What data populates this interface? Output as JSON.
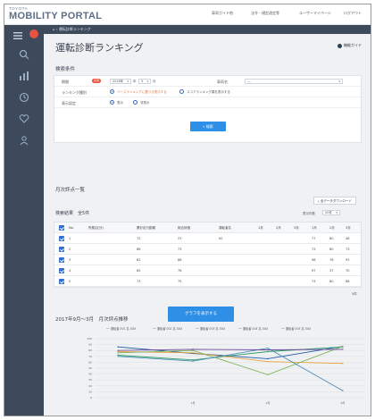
{
  "header": {
    "brand_small": "TOYOTA",
    "brand_big": "MOBILITY PORTAL",
    "nav": [
      "車両ガイド他",
      "法令・規定改定等",
      "ユーザーマイページ",
      "ログアウト"
    ]
  },
  "breadcrumb": {
    "text": "運転診断ランキング"
  },
  "page": {
    "title": "運転診断ランキング",
    "help_label": "機能ガイド"
  },
  "search": {
    "section_title": "検索条件",
    "required_badge": "必須",
    "period_label": "期間",
    "year_value": "2018年",
    "month_from": "5",
    "month_to": "月",
    "vehicle_label": "車両名",
    "vehicle_value": "---",
    "ranking_label": "ランキング種別",
    "ranking_opt1": "ベースランキングに基づき表示する",
    "ranking_opt2": "スコアランキング順を表示する",
    "display_label": "表示設定",
    "display_opt1": "表示",
    "display_opt2": "非表示",
    "search_button": "検索"
  },
  "results": {
    "section_title": "月次評点一覧",
    "export_label": "全データダウンロード",
    "count_label": "検索結果　全5件",
    "per_page_label": "表示件数",
    "per_page_value": "20件",
    "columns": [
      "No.",
      "所属(区分)",
      "累計走行距離",
      "総合評価",
      "運転者名",
      "1月",
      "2月",
      "3月",
      "1月",
      "2月",
      "3月"
    ],
    "rows": [
      [
        "1",
        "",
        "72",
        "37",
        "00",
        "",
        "",
        "",
        "77",
        "80",
        "48"
      ],
      [
        "2",
        "",
        "86",
        "73",
        "",
        "",
        "",
        "",
        "73",
        "80",
        "73"
      ],
      [
        "3",
        "",
        "62",
        "88",
        "",
        "",
        "",
        "",
        "98",
        "76",
        "93"
      ],
      [
        "4",
        "",
        "65",
        "76",
        "",
        "",
        "",
        "",
        "97",
        "37",
        "70"
      ],
      [
        "5",
        "",
        "73",
        "75",
        "",
        "",
        "",
        "",
        "73",
        "80",
        "88"
      ]
    ],
    "graph_button": "グラフを表示する"
  },
  "chart_data": {
    "type": "line",
    "title": "2017年9月〜3月　月次評点推移",
    "x": [
      "",
      "1月",
      "2月",
      "3月"
    ],
    "ylim": [
      0,
      100
    ],
    "yticks": [
      100,
      90,
      80,
      70,
      60,
      50,
      40,
      30,
      20,
      10,
      0
    ],
    "series": [
      {
        "values": [
          86,
          75,
          66,
          87
        ],
        "color": "#1f5aa6"
      },
      {
        "values": [
          72,
          64,
          78,
          86
        ],
        "color": "#2f9e63"
      },
      {
        "values": [
          78,
          76,
          61,
          58
        ],
        "color": "#e8a33a"
      },
      {
        "values": [
          76,
          80,
          39,
          87
        ],
        "color": "#7fb35a"
      },
      {
        "values": [
          70,
          62,
          84,
          12
        ],
        "color": "#4a8fb8"
      },
      {
        "values": [
          80,
          82,
          81,
          82
        ],
        "color": "#6c4a9e"
      }
    ],
    "legend": [
      "── 運転者 001 名 XXX",
      "── 運転者 002 名 XXX",
      "── 運転者 003 名 XXX",
      "── 運転者 004 名 XXX",
      "── 運転者 005 名 XXX"
    ]
  }
}
